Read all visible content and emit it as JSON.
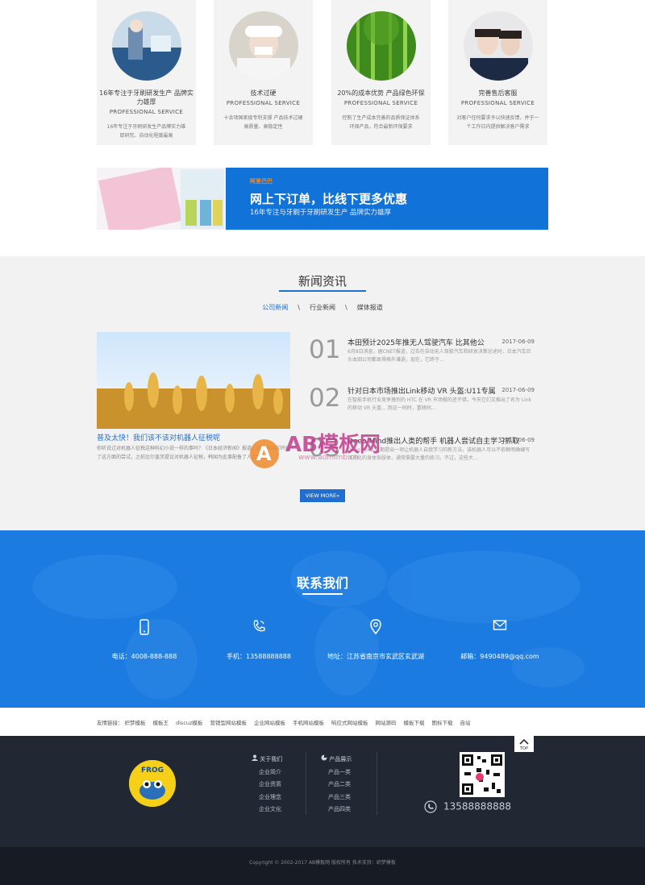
{
  "features": [
    {
      "title": "16年专注于牙刷研发生产 品牌实力雄厚",
      "sub": "PROFESSIONAL SERVICE",
      "desc": "16年专注于牙刷研发生产品牌实力雄厚研究、自动化程度最高"
    },
    {
      "title": "技术过硬",
      "sub": "PROFESSIONAL SERVICE",
      "desc": "十余项国家级专利支撑 产品技术过硬 高质量、高稳定性"
    },
    {
      "title": "20%的成本优势 产品绿色环保",
      "sub": "PROFESSIONAL SERVICE",
      "desc": "控制了生产成本完善的品质保证体系 环保产品，符合最新环保要求"
    },
    {
      "title": "完善售后客服",
      "sub": "PROFESSIONAL SERVICE",
      "desc": "对客户任何要求予以快速反馈，并于一个工作日内提供解决客户需求"
    }
  ],
  "banner": {
    "brand": "阿里巴巴",
    "headline": "网上下订单，比线下更多优惠",
    "subline": "16年专注与牙刷于牙刷研发生产 品牌实力雄厚"
  },
  "news": {
    "title": "新闻资讯",
    "tabs": [
      "公司新闻",
      "行业新闻",
      "媒体报道"
    ],
    "separator": "\\",
    "lead_title": "普及太快！我们该不该对机器人征税呢",
    "lead_desc": "你听说过对机器人征税这种科幻小说一样的事吗？《日本经济新闻》报道，近日韩国却开始了这方面的尝试，之前比尔盖茨提议对机器人征税，韩国为此事配备了人工智能机...",
    "items": [
      {
        "num": "01",
        "title": "本田预计2025年推无人驾驶汽车 比其他公",
        "date": "2017-06-09",
        "desc": "6月8日消息，据CNET报道，过去在自动无人驾驶汽车和研发决策论述时，日本汽车巨头本田公司都显得格外谦逊，现在，它终于..."
      },
      {
        "num": "02",
        "title": "针对日本市场推出Link移动 VR 头盔:U11专属",
        "date": "2017-06-09",
        "desc": "在智能手机行业竞争激烈的 HTC 在 VR 市场做的还不错，今天它们又推出了名为 Link 的移动 VR 头盔... 而这一同时，重磅同..."
      },
      {
        "num": "03",
        "title": "Deep Mind推出人类的帮手 机器人尝试自主学习抓取",
        "date": "2017-06-09",
        "desc": "Deep Mind 近期提出一项让机器人自我学习的新方法，该机器人可以不依赖明确编写可视化的身体各肢体，通常需要大量的练习。不过，这些大..."
      }
    ],
    "more": "VIEW MORE»"
  },
  "contact": {
    "title": "联系我们",
    "items": [
      {
        "icon": "mobile-icon",
        "text": "电话：4008-888-888"
      },
      {
        "icon": "phone-call-icon",
        "text": "手机：13588888888"
      },
      {
        "icon": "location-pin-icon",
        "text": "地址：江苏省南京市玄武区玄武湖"
      },
      {
        "icon": "mail-icon",
        "text": "邮箱：9490489@qq.com"
      }
    ]
  },
  "links": {
    "label": "友情链接：",
    "items": [
      "织梦模板",
      "模板王",
      "discuz模板",
      "营销型网站模板",
      "企业网站模板",
      "手机网站模板",
      "响应式网站模板",
      "网站源码",
      "模板下载",
      "图标下载",
      "自站"
    ]
  },
  "footer": {
    "about_head": "关于我们",
    "about_items": [
      "企业简介",
      "企业资质",
      "企业理念",
      "企业文化"
    ],
    "prod_head": "产品展示",
    "prod_items": [
      "产品一类",
      "产品二类",
      "产品三类",
      "产品四类"
    ],
    "phone": "13588888888",
    "top": "TOP",
    "logo_text": "FROG"
  },
  "copyright": "Copyright © 2002-2017 AB模板网 版权所有 技术支持：织梦模板",
  "watermark": {
    "brand": "AB模板网",
    "url": "www.admimb.cn"
  }
}
